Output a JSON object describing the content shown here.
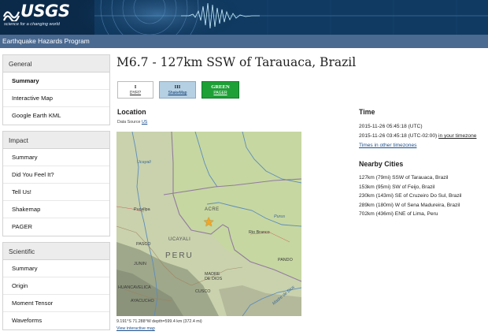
{
  "header": {
    "logo_text": "USGS",
    "logo_tagline": "science for a changing world",
    "program": "Earthquake Hazards Program"
  },
  "sidebar": {
    "sections": [
      {
        "title": "General",
        "items": [
          "Summary",
          "Interactive Map",
          "Google Earth KML"
        ],
        "active": 0
      },
      {
        "title": "Impact",
        "items": [
          "Summary",
          "Did You Feel It?",
          "Tell Us!",
          "Shakemap",
          "PAGER"
        ]
      },
      {
        "title": "Scientific",
        "items": [
          "Summary",
          "Origin",
          "Moment Tensor",
          "Waveforms"
        ]
      }
    ]
  },
  "event": {
    "title": "M6.7 - 127km SSW of Tarauaca, Brazil"
  },
  "badges": {
    "dyfi": {
      "value": "I",
      "label": "DYFI?"
    },
    "shakemap": {
      "value": "III",
      "label": "ShakeMap"
    },
    "pager": {
      "value": "GREEN",
      "label": "PAGER",
      "color": "#1fa037"
    }
  },
  "location": {
    "heading": "Location",
    "data_source_label": "Data Source",
    "data_source": "US",
    "coordinates": "9.191°S 71.288°W depth=599.4 km (372.4 mi)",
    "view_link": "View interactive map"
  },
  "map_labels": {
    "peru": "PERU",
    "acre": "ACRE",
    "ucayali": "UCAYALI",
    "pucallpa": "Pucallpa",
    "rio_branco": "Rio Branco",
    "pando": "PANDO",
    "pasco": "PASCO",
    "junin": "JUNIN",
    "madre_de_dios": "MADRE\nDE DIOS",
    "cusco": "CUSCO",
    "ayacucho": "AYACUCHO",
    "huancavelica": "HUANCAVELICA",
    "river_ucayali": "Ucayali",
    "river_purus": "Purus",
    "river_madre": "Madre de Dios"
  },
  "time": {
    "heading": "Time",
    "utc": "2015-11-26 05:45:18 (UTC)",
    "local_prefix": "2015-11-26 03:45:18 (UTC-02:00) ",
    "local_link": "in your timezone",
    "other_link": "Times in other timezones"
  },
  "nearby": {
    "heading": "Nearby Cities",
    "cities": [
      "127km (79mi) SSW of Tarauaca, Brazil",
      "153km (95mi) SW of Feijo, Brazil",
      "230km (143mi) SE of Cruzeiro Do Sul, Brazil",
      "289km (180mi) W of Sena Madureira, Brazil",
      "702km (436mi) ENE of Lima, Peru"
    ]
  },
  "colors": {
    "header_bg": "#0b2a4a",
    "subheader_bg": "#4b6a91",
    "link": "#1a4d8c",
    "pager_green": "#1fa037",
    "shakemap_blue": "#b5d0e3",
    "epicenter_star": "#f5a623"
  }
}
